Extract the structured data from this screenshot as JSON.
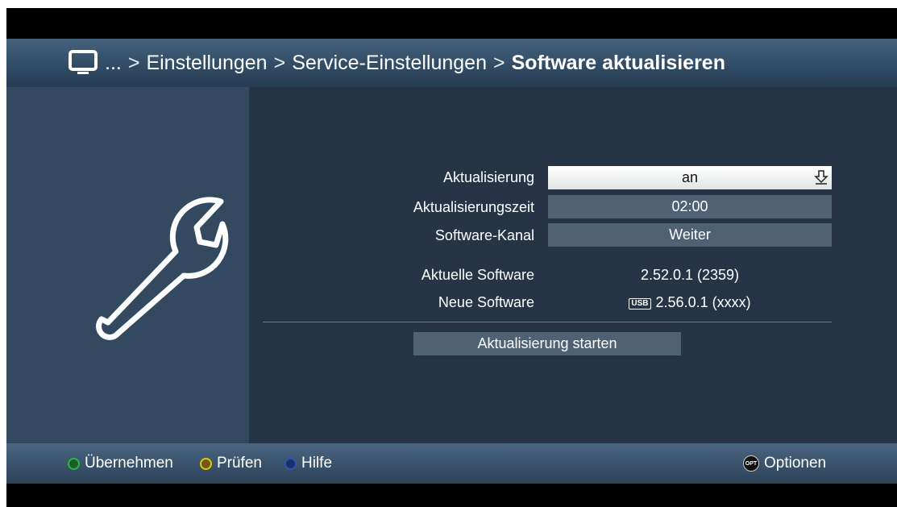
{
  "breadcrumb": {
    "ellipsis": "...",
    "separator": ">",
    "items": [
      "Einstellungen",
      "Service-Einstellungen"
    ],
    "current": "Software aktualisieren"
  },
  "settings": {
    "update_label": "Aktualisierung",
    "update_value": "an",
    "update_time_label": "Aktualisierungszeit",
    "update_time_value": "02:00",
    "channel_label": "Software-Kanal",
    "channel_value": "Weiter",
    "current_software_label": "Aktuelle Software",
    "current_software_value": "2.52.0.1 (2359)",
    "new_software_label": "Neue Software",
    "new_software_source": "USB",
    "new_software_value": "2.56.0.1 (xxxx)"
  },
  "start_button": "Aktualisierung starten",
  "footer": {
    "accept_label": "Übernehmen",
    "check_label": "Prüfen",
    "help_label": "Hilfe",
    "options_badge": "OPT",
    "options_label": "Optionen"
  },
  "colors": {
    "green_key": "#2db34a",
    "yellow_key": "#e2c21a",
    "blue_key": "#2b55b8",
    "panel": "#33495f",
    "background": "#263445"
  },
  "icons": {
    "header": "tv-icon",
    "left_panel": "wrench-icon",
    "dropdown": "download-arrow-icon"
  }
}
